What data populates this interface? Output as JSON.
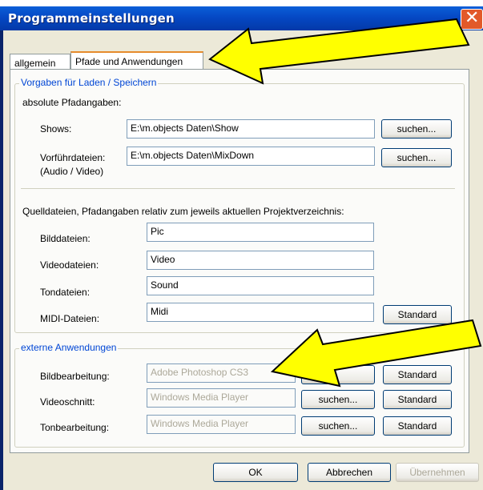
{
  "window": {
    "title": "Programmeinstellungen"
  },
  "tabs": [
    {
      "label": "allgemein"
    },
    {
      "label": "Pfade und Anwendungen"
    }
  ],
  "group_paths": {
    "legend": "Vorgaben für Laden / Speichern",
    "absolute_heading": "absolute Pfadangaben:",
    "shows": {
      "label": "Shows:",
      "value": "E:\\m.objects Daten\\Show",
      "button": "suchen..."
    },
    "vorfuehr": {
      "label": "Vorführdateien:",
      "label2": "(Audio / Video)",
      "value": "E:\\m.objects Daten\\MixDown",
      "button": "suchen..."
    },
    "relative_heading": "Quelldateien, Pfadangaben relativ zum jeweils aktuellen Projektverzeichnis:",
    "bild": {
      "label": "Bilddateien:",
      "value": "Pic"
    },
    "video": {
      "label": "Videodateien:",
      "value": "Video"
    },
    "ton": {
      "label": "Tondateien:",
      "value": "Sound"
    },
    "midi": {
      "label": "MIDI-Dateien:",
      "value": "Midi",
      "button": "Standard"
    }
  },
  "group_apps": {
    "legend": "externe Anwendungen",
    "bildbearbeitung": {
      "label": "Bildbearbeitung:",
      "value": "Adobe Photoshop CS3",
      "button_standard": "Standard"
    },
    "videoschnitt": {
      "label": "Videoschnitt:",
      "value": "Windows Media Player",
      "button_search": "suchen...",
      "button_standard": "Standard"
    },
    "tonbearbeitung": {
      "label": "Tonbearbeitung:",
      "value": "Windows Media Player",
      "button_search": "suchen...",
      "button_standard": "Standard"
    }
  },
  "footer": {
    "ok": "OK",
    "cancel": "Abbrechen",
    "apply": "Übernehmen"
  },
  "annotations": {
    "arrow_color": "#ffff00"
  }
}
